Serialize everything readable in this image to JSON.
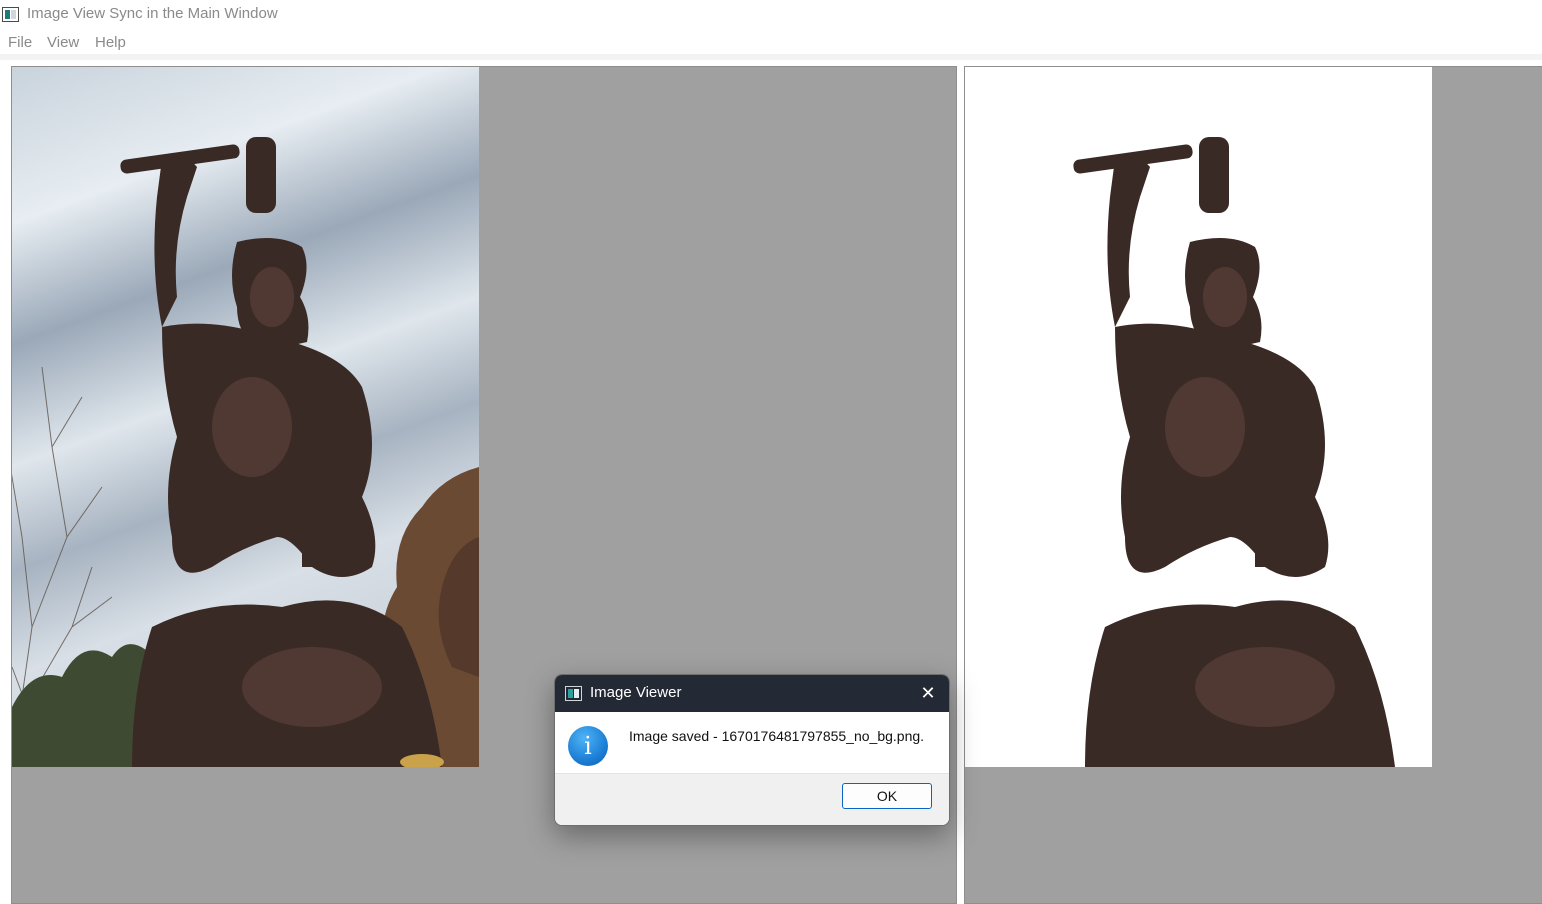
{
  "window": {
    "title": "Image View Sync in the Main Window"
  },
  "menubar": {
    "items": [
      "File",
      "View",
      "Help"
    ]
  },
  "panels": {
    "left": {
      "image": "bronze-statue-sculptor-with-hammer-and-chisel-original"
    },
    "right": {
      "image": "bronze-statue-sculptor-with-hammer-and-chisel-background-removed"
    }
  },
  "dialog": {
    "title": "Image Viewer",
    "message": "Image saved - 1670176481797855_no_bg.png.",
    "info_glyph": "i",
    "ok_label": "OK",
    "close_glyph": "✕"
  },
  "colors": {
    "viewer_background": "#a0a0a0",
    "dialog_titlebar": "#232a35",
    "accent": "#0a64c8",
    "info_blue": "#1c7fd6"
  }
}
